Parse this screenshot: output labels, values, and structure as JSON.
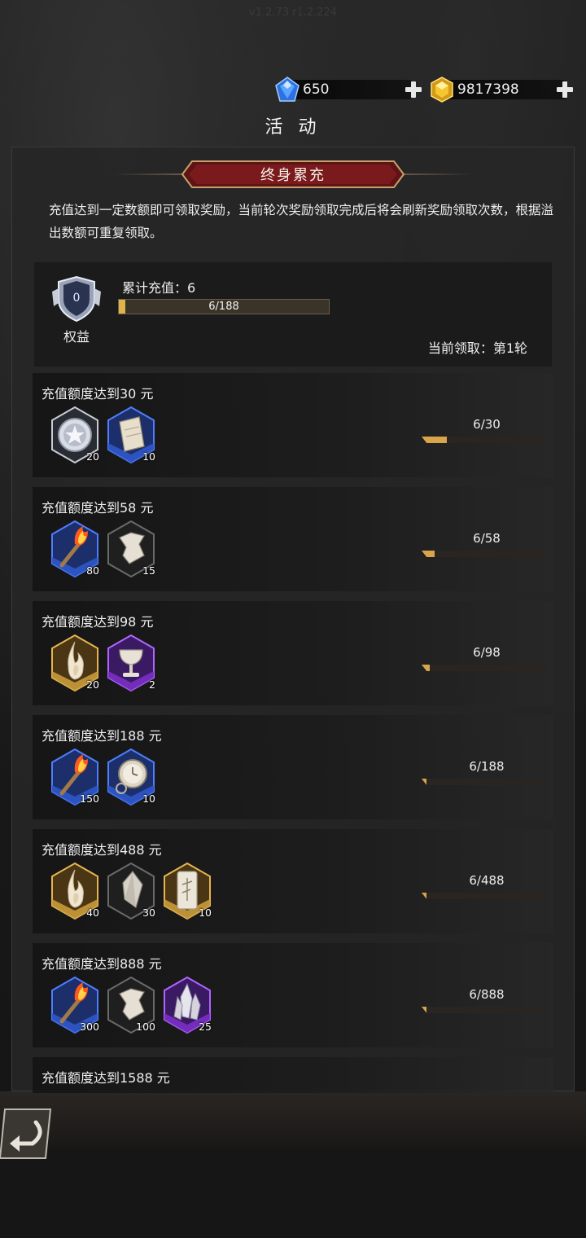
{
  "version": "v1.2.73 r1.2.224",
  "currencies": [
    {
      "name": "diamond",
      "icon": "blue-gem-icon",
      "value": "650"
    },
    {
      "name": "gold",
      "icon": "gold-gem-icon",
      "value": "9817398"
    }
  ],
  "page_title": "活 动",
  "banner_title": "终身累充",
  "description": "充值达到一定数额即可领取奖励，当前轮次奖励领取完成后将会刷新奖励领取次数，根据溢出数额可重复领取。",
  "summary": {
    "badge_level": "0",
    "badge_label": "权益",
    "total_label": "累计充值：6",
    "progress_text": "6/188",
    "progress_fraction": 0.032,
    "round_label": "当前领取：第1轮"
  },
  "tiers": [
    {
      "title": "充值额度达到30 元",
      "progress": "6/30",
      "fraction": 0.2,
      "items": [
        {
          "icon": "silver-star-coin-icon",
          "count": "20",
          "frame": "silver"
        },
        {
          "icon": "scroll-icon",
          "count": "10",
          "frame": "blue"
        }
      ]
    },
    {
      "title": "充值额度达到58 元",
      "progress": "6/58",
      "fraction": 0.103,
      "items": [
        {
          "icon": "torch-icon",
          "count": "80",
          "frame": "blue"
        },
        {
          "icon": "cloth-scrap-icon",
          "count": "15",
          "frame": "plain"
        }
      ]
    },
    {
      "title": "充值额度达到98 元",
      "progress": "6/98",
      "fraction": 0.061,
      "items": [
        {
          "icon": "flame-essence-icon",
          "count": "20",
          "frame": "gold"
        },
        {
          "icon": "chalice-icon",
          "count": "2",
          "frame": "purple"
        }
      ]
    },
    {
      "title": "充值额度达到188 元",
      "progress": "6/188",
      "fraction": 0.032,
      "items": [
        {
          "icon": "torch-icon",
          "count": "150",
          "frame": "blue"
        },
        {
          "icon": "pocket-watch-icon",
          "count": "10",
          "frame": "blue"
        }
      ]
    },
    {
      "title": "充值额度达到488 元",
      "progress": "6/488",
      "fraction": 0.012,
      "items": [
        {
          "icon": "flame-essence-icon",
          "count": "40",
          "frame": "gold"
        },
        {
          "icon": "crystal-shard-icon",
          "count": "30",
          "frame": "plain"
        },
        {
          "icon": "rune-tablet-icon",
          "count": "10",
          "frame": "gold"
        }
      ]
    },
    {
      "title": "充值额度达到888 元",
      "progress": "6/888",
      "fraction": 0.007,
      "items": [
        {
          "icon": "torch-icon",
          "count": "300",
          "frame": "blue"
        },
        {
          "icon": "cloth-scrap-icon",
          "count": "100",
          "frame": "plain"
        },
        {
          "icon": "crystal-cluster-icon",
          "count": "25",
          "frame": "purple"
        }
      ]
    },
    {
      "title": "充值额度达到1588 元"
    }
  ],
  "colors": {
    "accent_gold": "#d8a54a",
    "banner_red": "#7a1a1c",
    "frame_blue": "#2f58c9",
    "frame_purple": "#7b2fc4",
    "frame_gold": "#c99a3a"
  }
}
